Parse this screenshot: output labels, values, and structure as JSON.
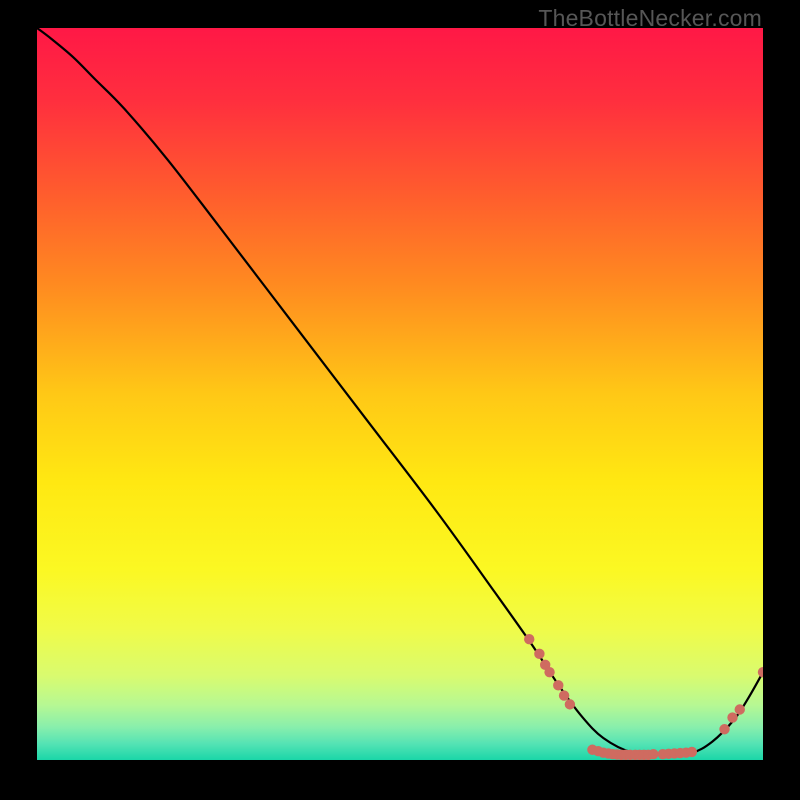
{
  "watermark": "TheBottleNecker.com",
  "chart_data": {
    "type": "line",
    "title": "",
    "xlabel": "",
    "ylabel": "",
    "xlim": [
      0,
      100
    ],
    "ylim": [
      0,
      100
    ],
    "grid": false,
    "background_gradient": {
      "stops": [
        {
          "offset": 0.0,
          "color": "#ff1846"
        },
        {
          "offset": 0.1,
          "color": "#ff2f3e"
        },
        {
          "offset": 0.22,
          "color": "#ff5a2e"
        },
        {
          "offset": 0.35,
          "color": "#ff8a20"
        },
        {
          "offset": 0.5,
          "color": "#ffc816"
        },
        {
          "offset": 0.62,
          "color": "#ffe812"
        },
        {
          "offset": 0.74,
          "color": "#fbf823"
        },
        {
          "offset": 0.82,
          "color": "#f0fb48"
        },
        {
          "offset": 0.885,
          "color": "#d9fb6f"
        },
        {
          "offset": 0.925,
          "color": "#b6f893"
        },
        {
          "offset": 0.955,
          "color": "#88efac"
        },
        {
          "offset": 0.978,
          "color": "#54e3b4"
        },
        {
          "offset": 1.0,
          "color": "#1ad6a8"
        }
      ]
    },
    "series": [
      {
        "name": "bottleneck-curve",
        "type": "line",
        "color": "#000000",
        "x_percent": [
          0.0,
          2.0,
          5.0,
          8.0,
          12.0,
          18.0,
          25.0,
          35.0,
          45.0,
          55.0,
          63.0,
          68.0,
          72.0,
          75.0,
          78.0,
          82.0,
          86.0,
          90.0,
          93.0,
          96.0,
          98.0,
          100.0
        ],
        "y_percent": [
          100.0,
          98.5,
          96.0,
          93.0,
          89.0,
          82.0,
          73.0,
          60.0,
          47.0,
          34.0,
          23.0,
          16.0,
          10.0,
          6.0,
          3.0,
          1.0,
          0.7,
          0.9,
          2.5,
          5.5,
          8.5,
          12.0
        ]
      },
      {
        "name": "data-points-left-cluster",
        "type": "scatter",
        "color": "#cf6b60",
        "x_percent": [
          67.8,
          69.2,
          70.0,
          70.6,
          71.8,
          72.6,
          73.4
        ],
        "y_percent": [
          16.5,
          14.5,
          13.0,
          12.0,
          10.2,
          8.8,
          7.6
        ]
      },
      {
        "name": "data-points-bottom-cluster",
        "type": "scatter",
        "color": "#cf6b60",
        "x_percent": [
          76.5,
          77.3,
          78.0,
          78.7,
          79.3,
          79.9,
          80.5,
          81.1,
          81.7,
          82.4,
          83.0,
          83.6,
          84.2,
          84.9,
          86.2,
          87.0,
          87.8,
          88.6,
          89.4,
          90.2
        ],
        "y_percent": [
          1.4,
          1.2,
          1.0,
          0.9,
          0.8,
          0.75,
          0.7,
          0.7,
          0.7,
          0.7,
          0.7,
          0.7,
          0.7,
          0.8,
          0.8,
          0.85,
          0.9,
          0.95,
          1.0,
          1.1
        ]
      },
      {
        "name": "data-points-right-cluster",
        "type": "scatter",
        "color": "#cf6b60",
        "x_percent": [
          94.7,
          95.8,
          96.8,
          100.0
        ],
        "y_percent": [
          4.2,
          5.8,
          6.9,
          12.0
        ]
      }
    ]
  }
}
